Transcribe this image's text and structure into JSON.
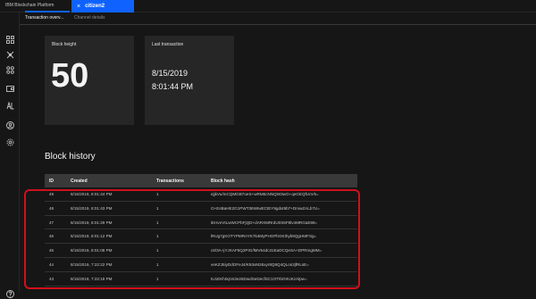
{
  "header": {
    "brand": "IBM Blockchain Platform",
    "channel_tab": "citizen2"
  },
  "subtabs": [
    "Transaction overv...",
    "Channel details"
  ],
  "cards": {
    "block_height": {
      "label": "Block height",
      "value": "50"
    },
    "last_transaction": {
      "label": "Last transaction",
      "date": "8/15/2019",
      "time": "8:01:44 PM"
    }
  },
  "block_history": {
    "title": "Block history",
    "columns": [
      "ID",
      "Created",
      "Transactions",
      "Block hash"
    ],
    "rows": [
      [
        "49",
        "8/15/2019, 8:01:44 PM",
        "1",
        "ejjkVu/mCQMGB7oeS+wRM6cNNQW3wG+qeGEQfUnVk="
      ],
      [
        "48",
        "8/15/2019, 8:01:43 PM",
        "1",
        "O+EsBaHE2G1PWT36WIwECtEY9gdxt9b7+DmwZALb7U="
      ],
      [
        "47",
        "8/15/2019, 8:01:29 PM",
        "1",
        "iEHvnVtLwWCPbFjQD+dARXMRrdU0S5F8lv4MRGaE98="
      ],
      [
        "46",
        "8/15/2019, 8:01:12 PM",
        "1",
        "lRUg7gKOTYPMRAYK7k4MyPHGPhGKthyb9QgHMFSg="
      ],
      [
        "45",
        "8/15/2019, 8:01:08 PM",
        "1",
        "c8/3A+jYJXAF5Q2PIG/lMV54dc31EaDCQeSA+DPRmgMM="
      ],
      [
        "44",
        "8/15/2019, 7:22:22 PM",
        "1",
        "veKZJ5iyDdOFeJ4/K93vM26xyr8Q8Q4QLos3jfRLsE="
      ],
      [
        "43",
        "8/15/2019, 7:22:18 PM",
        "1",
        "tU1EKh0qVo3e26DwdSeDecfSC1OTIbOIrUKzAlpw="
      ]
    ]
  }
}
